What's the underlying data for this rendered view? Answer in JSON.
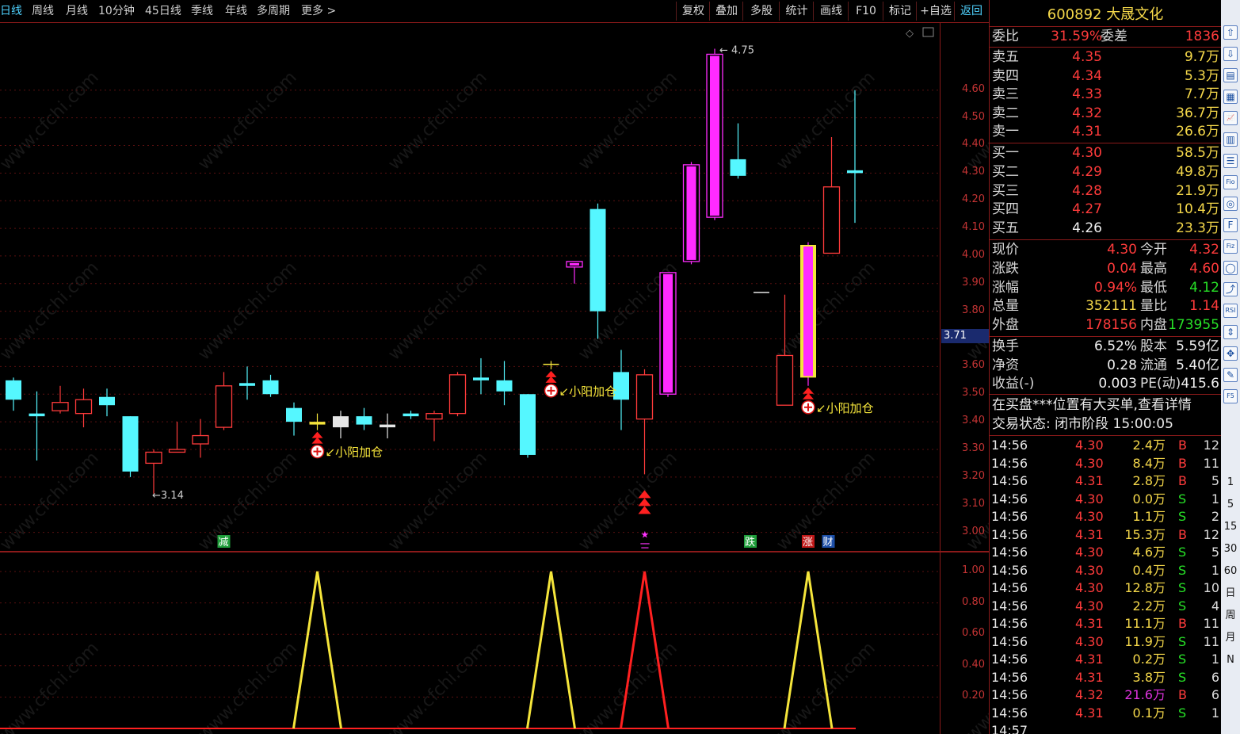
{
  "toolbar": {
    "periods": [
      "日线",
      "周线",
      "月线",
      "10分钟",
      "45日线",
      "季线",
      "年线",
      "多周期",
      "更多 >"
    ],
    "active_period": "日线",
    "buttons": [
      "复权",
      "叠加",
      "多股",
      "统计",
      "画线",
      "F10",
      "标记",
      "+自选",
      "返回"
    ]
  },
  "main_axis": {
    "ticks": [
      "4.60",
      "4.50",
      "4.40",
      "4.30",
      "4.20",
      "4.10",
      "4.00",
      "3.90",
      "3.80",
      "3.70",
      "3.60",
      "3.50",
      "3.40",
      "3.30",
      "3.20",
      "3.10",
      "3.00"
    ],
    "current_price_label": "3.71"
  },
  "sub_axis": {
    "ticks": [
      "1.00",
      "0.80",
      "0.60",
      "0.40",
      "0.20"
    ]
  },
  "annotations": {
    "high_label": "4.75",
    "low_label": "3.14",
    "signal_label": "小阳加仓",
    "star_label": "三",
    "markers": [
      "减",
      "跌",
      "涨",
      "财"
    ]
  },
  "chart_data": {
    "type": "candlestick",
    "ylim": [
      2.95,
      4.78
    ],
    "candles": [
      {
        "o": 3.48,
        "c": 3.55,
        "h": 3.56,
        "l": 3.44,
        "color": "cyan"
      },
      {
        "o": 3.43,
        "c": 3.42,
        "h": 3.51,
        "l": 3.26,
        "color": "cyan"
      },
      {
        "o": 3.47,
        "c": 3.44,
        "h": 3.53,
        "l": 3.43,
        "color": "red"
      },
      {
        "o": 3.48,
        "c": 3.43,
        "h": 3.52,
        "l": 3.38,
        "color": "red"
      },
      {
        "o": 3.46,
        "c": 3.49,
        "h": 3.52,
        "l": 3.42,
        "color": "cyan"
      },
      {
        "o": 3.42,
        "c": 3.22,
        "h": 3.42,
        "l": 3.2,
        "color": "cyan"
      },
      {
        "o": 3.25,
        "c": 3.29,
        "h": 3.3,
        "l": 3.14,
        "color": "red"
      },
      {
        "o": 3.3,
        "c": 3.29,
        "h": 3.4,
        "l": 3.29,
        "color": "red"
      },
      {
        "o": 3.35,
        "c": 3.32,
        "h": 3.41,
        "l": 3.27,
        "color": "red"
      },
      {
        "o": 3.53,
        "c": 3.38,
        "h": 3.58,
        "l": 3.37,
        "color": "red"
      },
      {
        "o": 3.54,
        "c": 3.53,
        "h": 3.6,
        "l": 3.48,
        "color": "cyan"
      },
      {
        "o": 3.55,
        "c": 3.5,
        "h": 3.57,
        "l": 3.49,
        "color": "cyan"
      },
      {
        "o": 3.45,
        "c": 3.4,
        "h": 3.47,
        "l": 3.35,
        "color": "cyan"
      },
      {
        "o": 3.4,
        "c": 3.39,
        "h": 3.43,
        "l": 3.37,
        "color": "yellow"
      },
      {
        "o": 3.42,
        "c": 3.38,
        "h": 3.44,
        "l": 3.34,
        "color": "white"
      },
      {
        "o": 3.42,
        "c": 3.39,
        "h": 3.45,
        "l": 3.37,
        "color": "cyan"
      },
      {
        "o": 3.39,
        "c": 3.38,
        "h": 3.43,
        "l": 3.34,
        "color": "white"
      },
      {
        "o": 3.43,
        "c": 3.42,
        "h": 3.44,
        "l": 3.41,
        "color": "cyan"
      },
      {
        "o": 3.41,
        "c": 3.43,
        "h": 3.44,
        "l": 3.33,
        "color": "red"
      },
      {
        "o": 3.43,
        "c": 3.57,
        "h": 3.58,
        "l": 3.42,
        "color": "red"
      },
      {
        "o": 3.56,
        "c": 3.55,
        "h": 3.63,
        "l": 3.5,
        "color": "cyan"
      },
      {
        "o": 3.55,
        "c": 3.51,
        "h": 3.62,
        "l": 3.46,
        "color": "cyan"
      },
      {
        "o": 3.5,
        "c": 3.28,
        "h": 3.5,
        "l": 3.27,
        "color": "cyan"
      },
      {
        "o": 3.61,
        "c": 3.61,
        "h": 3.62,
        "l": 3.59,
        "color": "yellow"
      },
      {
        "o": 3.98,
        "c": 3.96,
        "h": 3.98,
        "l": 3.9,
        "color": "magenta"
      },
      {
        "o": 4.17,
        "c": 3.8,
        "h": 4.19,
        "l": 3.7,
        "color": "cyan"
      },
      {
        "o": 3.58,
        "c": 3.48,
        "h": 3.66,
        "l": 3.37,
        "color": "cyan"
      },
      {
        "o": 3.41,
        "c": 3.57,
        "h": 3.59,
        "l": 3.21,
        "color": "red"
      },
      {
        "o": 3.5,
        "c": 3.94,
        "h": 3.94,
        "l": 3.49,
        "color": "magenta"
      },
      {
        "o": 3.98,
        "c": 4.33,
        "h": 4.34,
        "l": 3.97,
        "color": "magenta"
      },
      {
        "o": 4.14,
        "c": 4.73,
        "h": 4.75,
        "l": 4.13,
        "color": "magenta"
      },
      {
        "o": 4.35,
        "c": 4.29,
        "h": 4.48,
        "l": 4.28,
        "color": "cyan"
      },
      {
        "o": 3.87,
        "c": 3.87,
        "h": 3.87,
        "l": 3.87,
        "color": "white"
      },
      {
        "o": 3.46,
        "c": 3.64,
        "h": 3.86,
        "l": 3.46,
        "color": "red"
      },
      {
        "o": 3.56,
        "c": 4.04,
        "h": 4.05,
        "l": 3.53,
        "color": "yellow-magenta"
      },
      {
        "o": 4.01,
        "c": 4.25,
        "h": 4.43,
        "l": 4.01,
        "color": "red"
      },
      {
        "o": 4.31,
        "c": 4.3,
        "h": 4.6,
        "l": 4.12,
        "color": "cyan"
      }
    ],
    "signal": {
      "peaks_at": [
        13,
        23,
        27,
        34
      ],
      "peak_value": 1.0,
      "red_peak": 27
    }
  },
  "quote": {
    "code": "600892",
    "name": "大晟文化",
    "weibi_label": "委比",
    "weibi_value": "31.59%",
    "weicha_label": "委差",
    "weicha_value": "1836",
    "asks": [
      {
        "label": "卖五",
        "price": "4.35",
        "vol": "9.7万"
      },
      {
        "label": "卖四",
        "price": "4.34",
        "vol": "5.3万"
      },
      {
        "label": "卖三",
        "price": "4.33",
        "vol": "7.7万"
      },
      {
        "label": "卖二",
        "price": "4.32",
        "vol": "36.7万"
      },
      {
        "label": "卖一",
        "price": "4.31",
        "vol": "26.6万"
      }
    ],
    "bids": [
      {
        "label": "买一",
        "price": "4.30",
        "vol": "58.5万"
      },
      {
        "label": "买二",
        "price": "4.29",
        "vol": "49.8万"
      },
      {
        "label": "买三",
        "price": "4.28",
        "vol": "21.9万"
      },
      {
        "label": "买四",
        "price": "4.27",
        "vol": "10.4万"
      },
      {
        "label": "买五",
        "price": "4.26",
        "vol": "23.3万"
      }
    ],
    "stats": [
      {
        "l1": "现价",
        "v1": "4.30",
        "l2": "今开",
        "v2": "4.32"
      },
      {
        "l1": "涨跌",
        "v1": "0.04",
        "l2": "最高",
        "v2": "4.60"
      },
      {
        "l1": "涨幅",
        "v1": "0.94%",
        "l2": "最低",
        "v2": "4.12"
      },
      {
        "l1": "总量",
        "v1": "352111",
        "l2": "量比",
        "v2": "1.14"
      },
      {
        "l1": "外盘",
        "v1": "178156",
        "l2": "内盘",
        "v2": "173955"
      }
    ],
    "fund": [
      {
        "l1": "换手",
        "v1": "6.52%",
        "l2": "股本",
        "v2": "5.59亿"
      },
      {
        "l1": "净资",
        "v1": "0.28",
        "l2": "流通",
        "v2": "5.40亿"
      },
      {
        "l1": "收益(-)",
        "v1": "0.003",
        "l2": "PE(动)",
        "v2": "415.6"
      }
    ],
    "notice": "在买盘***位置有大买单,查看详情",
    "status": "交易状态: 闭市阶段 15:00:05",
    "ticks": [
      {
        "t": "14:56",
        "p": "4.30",
        "v": "2.4万",
        "s": "B",
        "n": "12"
      },
      {
        "t": "14:56",
        "p": "4.30",
        "v": "8.4万",
        "s": "B",
        "n": "11"
      },
      {
        "t": "14:56",
        "p": "4.31",
        "v": "2.8万",
        "s": "B",
        "n": "5"
      },
      {
        "t": "14:56",
        "p": "4.30",
        "v": "0.0万",
        "s": "S",
        "n": "1"
      },
      {
        "t": "14:56",
        "p": "4.30",
        "v": "1.1万",
        "s": "S",
        "n": "2"
      },
      {
        "t": "14:56",
        "p": "4.31",
        "v": "15.3万",
        "s": "B",
        "n": "12"
      },
      {
        "t": "14:56",
        "p": "4.30",
        "v": "4.6万",
        "s": "S",
        "n": "5"
      },
      {
        "t": "14:56",
        "p": "4.30",
        "v": "0.4万",
        "s": "S",
        "n": "1"
      },
      {
        "t": "14:56",
        "p": "4.30",
        "v": "12.8万",
        "s": "S",
        "n": "10"
      },
      {
        "t": "14:56",
        "p": "4.30",
        "v": "2.2万",
        "s": "S",
        "n": "4"
      },
      {
        "t": "14:56",
        "p": "4.31",
        "v": "11.1万",
        "s": "B",
        "n": "11"
      },
      {
        "t": "14:56",
        "p": "4.30",
        "v": "11.9万",
        "s": "S",
        "n": "11"
      },
      {
        "t": "14:56",
        "p": "4.31",
        "v": "0.2万",
        "s": "S",
        "n": "1"
      },
      {
        "t": "14:56",
        "p": "4.31",
        "v": "3.8万",
        "s": "S",
        "n": "6"
      },
      {
        "t": "14:56",
        "p": "4.32",
        "v": "21.6万",
        "s": "B",
        "n": "6"
      },
      {
        "t": "14:56",
        "p": "4.31",
        "v": "0.1万",
        "s": "S",
        "n": "1"
      },
      {
        "t": "14:57",
        "p": "",
        "v": "",
        "s": "",
        "n": ""
      }
    ]
  },
  "iconbar": {
    "labels": [
      "1",
      "5",
      "15",
      "30",
      "60",
      "日",
      "周",
      "月",
      "N"
    ],
    "icons": [
      "arrow-up-icon",
      "arrow-down-icon",
      "news-icon",
      "table-icon",
      "chart-icon",
      "bar-icon",
      "list-icon",
      "fio-icon",
      "circle-icon",
      "f10-icon",
      "fiz-icon",
      "ring-icon",
      "trend-icon",
      "rsi-icon",
      "up-down-icon",
      "move-icon",
      "pen-icon",
      "f5-icon"
    ]
  }
}
